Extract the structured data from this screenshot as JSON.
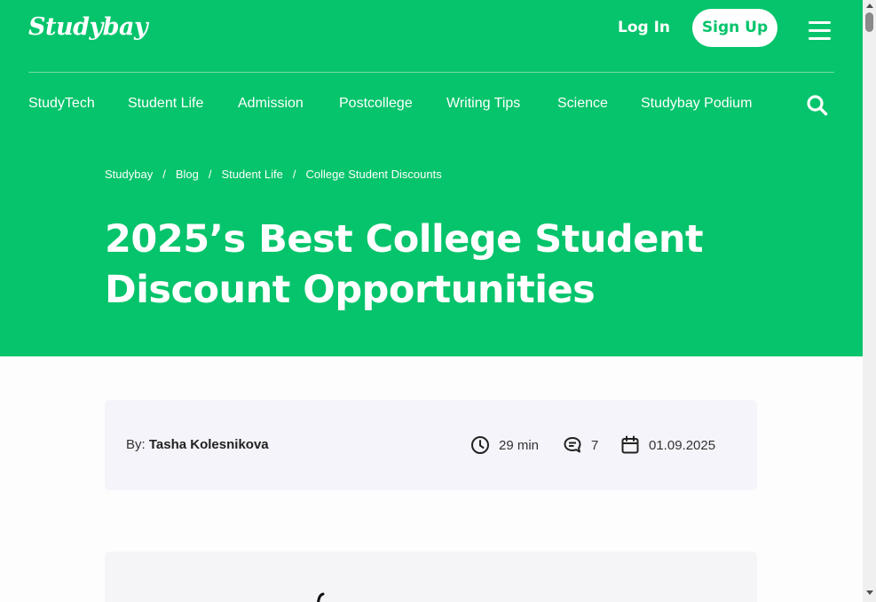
{
  "colors": {
    "brand_green": "#05c46b",
    "meta_bg": "#f4f4fa"
  },
  "header": {
    "logo": "Studybay",
    "login_label": "Log In",
    "signup_label": "Sign Up",
    "menu_icon": "hamburger-menu-icon"
  },
  "nav": {
    "items": [
      "StudyTech",
      "Student Life",
      "Admission",
      "Postcollege",
      "Writing Tips",
      "Science",
      "Studybay Podium"
    ],
    "search_icon": "search-icon"
  },
  "breadcrumb": {
    "items": [
      "Studybay",
      "Blog",
      "Student Life",
      "College Student Discounts"
    ],
    "separator": "/"
  },
  "article": {
    "title_line1": "2025’s Best College Student",
    "title_line2": "Discount Opportunities"
  },
  "meta": {
    "by_label": "By:",
    "author": "Tasha Kolesnikova",
    "read_time": "29 min",
    "comments": "7",
    "date": "01.09.2025",
    "icons": [
      "clock-icon",
      "comment-icon",
      "calendar-icon"
    ]
  }
}
